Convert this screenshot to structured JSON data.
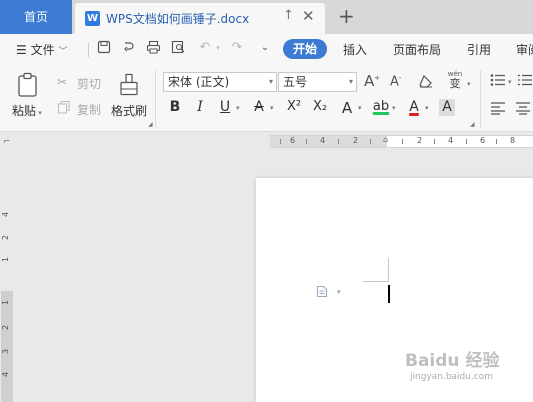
{
  "tabs": {
    "home": "首页",
    "doc_icon": "W",
    "doc_title": "WPS文档如何画锤子.docx",
    "pin_glyph": "↑",
    "close_glyph": "✕",
    "add_glyph": "+"
  },
  "menu": {
    "file_label": "文件",
    "items": [
      "开始",
      "插入",
      "页面布局",
      "引用",
      "审阅"
    ]
  },
  "ribbon": {
    "paste": "粘贴",
    "cut": "剪切",
    "copy": "复制",
    "format_painter": "格式刷",
    "font_name": "宋体 (正文)",
    "font_size": "五号",
    "wen_glyph": "wén",
    "wen_char": "变",
    "bold": "B",
    "italic": "I",
    "underline": "U",
    "strike": "A",
    "superscript": "X²",
    "subscript": "X₂",
    "text_effect": "A",
    "highlight": "ab",
    "font_color": "A",
    "char_shading": "A",
    "grow_font": "A",
    "shrink_font": "A"
  },
  "rulers": {
    "h_numbers": [
      "6",
      "4",
      "2",
      "2",
      "4",
      "6",
      "8"
    ],
    "v_numbers": [
      "4",
      "2",
      "1",
      "1",
      "2",
      "3",
      "4"
    ]
  },
  "watermark": {
    "main": "Baidu 经验",
    "url": "jingyan.baidu.com"
  },
  "colors": {
    "accent": "#3c7bd1",
    "highlight_bar": "#22c55e",
    "font_color_bar": "#e02020"
  }
}
